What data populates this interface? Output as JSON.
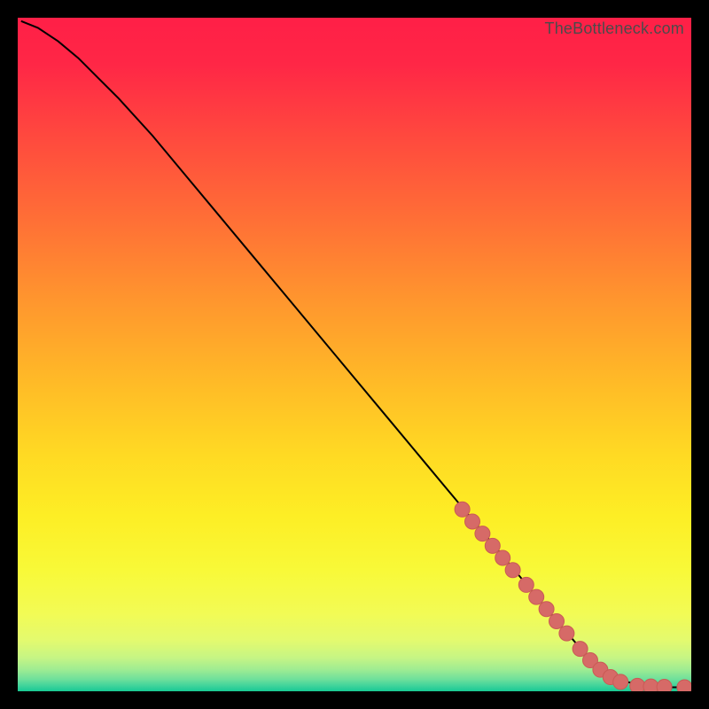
{
  "watermark": "TheBottleneck.com",
  "colors": {
    "bg_black": "#000000",
    "marker_fill": "#d66a67",
    "marker_stroke": "#c95a55",
    "curve": "#000000"
  },
  "chart_data": {
    "type": "line",
    "title": "",
    "xlabel": "",
    "ylabel": "",
    "xlim": [
      0,
      100
    ],
    "ylim": [
      0,
      100
    ],
    "series": [
      {
        "name": "curve",
        "x": [
          0.5,
          3,
          6,
          9,
          12,
          15,
          20,
          25,
          30,
          35,
          40,
          45,
          50,
          55,
          60,
          65,
          70,
          75,
          80,
          83,
          85,
          87,
          90,
          93,
          96,
          99.5
        ],
        "y": [
          99.5,
          98.5,
          96.5,
          94,
          91,
          88,
          82.5,
          76.5,
          70.5,
          64.5,
          58.5,
          52.5,
          46.5,
          40.5,
          34.5,
          28.5,
          22.5,
          16.5,
          10.5,
          7,
          4.8,
          3,
          1.5,
          0.8,
          0.6,
          0.6
        ]
      }
    ],
    "markers": {
      "name": "highlight-points",
      "x": [
        66,
        67.5,
        69,
        70.5,
        72,
        73.5,
        75.5,
        77,
        78.5,
        80,
        81.5,
        83.5,
        85,
        86.5,
        88,
        89.5,
        92,
        94,
        96,
        99
      ],
      "y": [
        27,
        25.2,
        23.4,
        21.6,
        19.8,
        18,
        15.8,
        14,
        12.2,
        10.4,
        8.6,
        6.3,
        4.6,
        3.2,
        2.1,
        1.4,
        0.8,
        0.7,
        0.65,
        0.6
      ]
    },
    "gradient_bands": [
      {
        "stop": 0.0,
        "color": "#ff1f47"
      },
      {
        "stop": 0.07,
        "color": "#ff2746"
      },
      {
        "stop": 0.18,
        "color": "#ff4a3e"
      },
      {
        "stop": 0.3,
        "color": "#ff6f36"
      },
      {
        "stop": 0.42,
        "color": "#ff962e"
      },
      {
        "stop": 0.54,
        "color": "#ffba27"
      },
      {
        "stop": 0.65,
        "color": "#ffda23"
      },
      {
        "stop": 0.74,
        "color": "#fdee25"
      },
      {
        "stop": 0.82,
        "color": "#f8f938"
      },
      {
        "stop": 0.885,
        "color": "#f2fb55"
      },
      {
        "stop": 0.925,
        "color": "#e3fa6f"
      },
      {
        "stop": 0.95,
        "color": "#c6f584"
      },
      {
        "stop": 0.968,
        "color": "#9eec92"
      },
      {
        "stop": 0.982,
        "color": "#6fe09b"
      },
      {
        "stop": 0.992,
        "color": "#3fd39b"
      },
      {
        "stop": 1.0,
        "color": "#18c994"
      }
    ]
  }
}
